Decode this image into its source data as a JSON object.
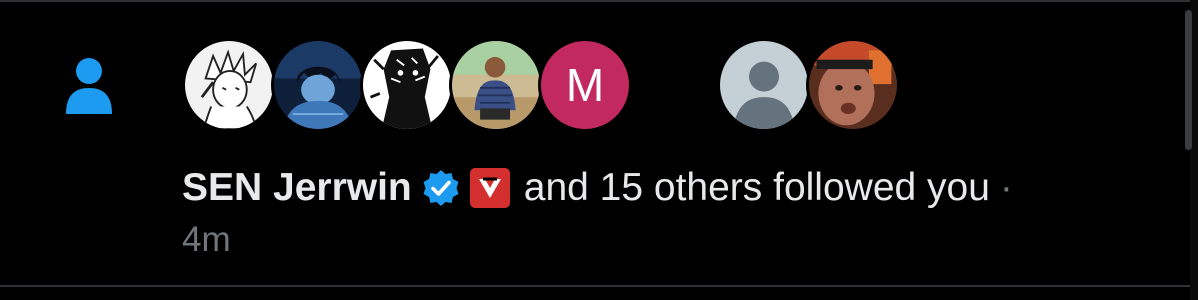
{
  "notification": {
    "type_icon": "person-icon",
    "avatars": [
      {
        "name": "avatar-1-anime-sketch"
      },
      {
        "name": "avatar-2-anime-blue"
      },
      {
        "name": "avatar-3-bw-art"
      },
      {
        "name": "avatar-4-photo-man"
      },
      {
        "name": "avatar-5-letter",
        "letter": "M"
      },
      {
        "name": "avatar-6-default"
      },
      {
        "name": "avatar-7-photo-face"
      }
    ],
    "user_name": "SEN Jerrwin",
    "verified_icon": "verified-badge-icon",
    "brand_icon": "brand-badge-icon",
    "message": "and 15 others followed you",
    "separator": "·",
    "timestamp": "4m"
  },
  "colors": {
    "background": "#000000",
    "text_primary": "#e7e9ea",
    "text_secondary": "#71767b",
    "accent_blue": "#1d9bf0",
    "letter_avatar": "#c2295e",
    "brand_red": "#d32f2f"
  }
}
